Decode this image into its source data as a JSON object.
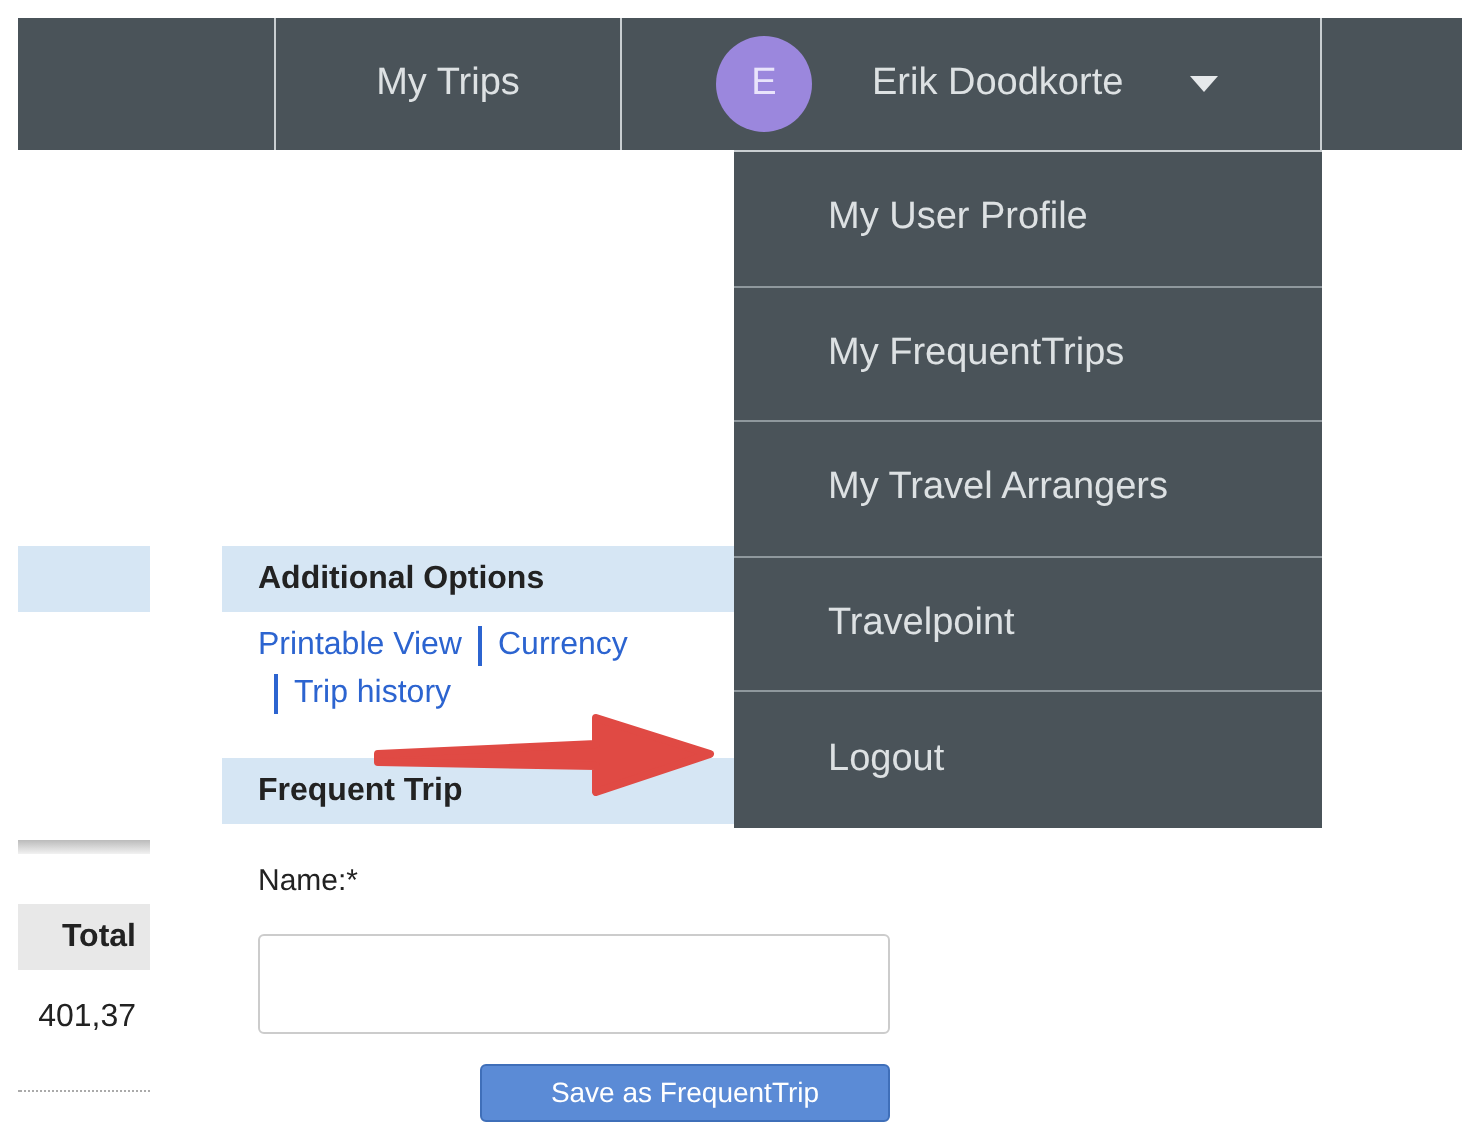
{
  "navbar": {
    "items": [
      {
        "label": "My Trips"
      }
    ],
    "user": {
      "initial": "E",
      "name": "Erik Doodkorte",
      "color": "#9b87dd",
      "expanded": true
    }
  },
  "user_menu": [
    {
      "label": "My User Profile"
    },
    {
      "label": "My FrequentTrips"
    },
    {
      "label": "My Travel Arrangers"
    },
    {
      "label": "Travelpoint"
    },
    {
      "label": "Logout"
    }
  ],
  "table": {
    "columns": [
      "Total"
    ],
    "rows": [
      [
        "401,37"
      ]
    ]
  },
  "additional_options": {
    "title": "Additional Options",
    "links": [
      "Printable View",
      "Currency",
      "Trip history"
    ]
  },
  "frequent_trip": {
    "title": "Frequent Trip",
    "name_label": "Name:*",
    "button": "Save as FrequentTrip"
  },
  "annotation": {
    "kind": "arrow"
  }
}
